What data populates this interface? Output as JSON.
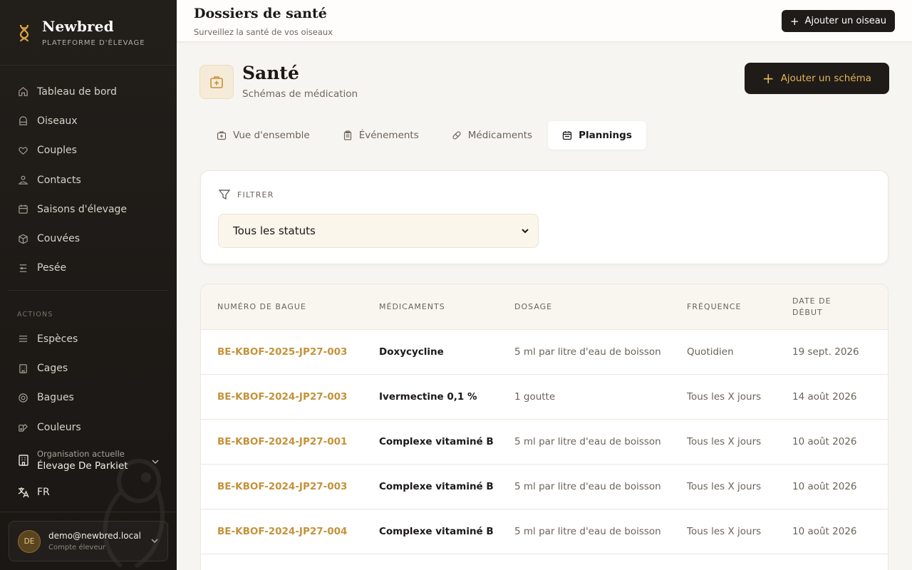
{
  "app": {
    "name": "Newbred",
    "tagline": "PLATEFORME D'ÉLEVAGE"
  },
  "sidebar": {
    "items": [
      {
        "label": "Tableau de bord",
        "icon": "home-icon"
      },
      {
        "label": "Oiseaux",
        "icon": "cage-icon"
      },
      {
        "label": "Couples",
        "icon": "heart-icon"
      },
      {
        "label": "Contacts",
        "icon": "users-icon"
      },
      {
        "label": "Saisons d'élevage",
        "icon": "calendar-icon"
      },
      {
        "label": "Couvées",
        "icon": "box-icon"
      },
      {
        "label": "Pesée",
        "icon": "scale-icon"
      }
    ],
    "actions_title": "ACTIONS",
    "actions": [
      {
        "label": "Espèces",
        "icon": "list-icon"
      },
      {
        "label": "Cages",
        "icon": "building-icon"
      },
      {
        "label": "Bagues",
        "icon": "ring-icon"
      },
      {
        "label": "Couleurs",
        "icon": "palette-icon"
      }
    ],
    "org_label": "Organisation actuelle",
    "org_name": "Élevage De Parkiet",
    "language": "FR",
    "user": {
      "initials": "DE",
      "email": "demo@newbred.local",
      "role": "Compte éleveur"
    }
  },
  "header": {
    "title": "Dossiers de santé",
    "subtitle": "Surveillez la santé de vos oiseaux",
    "add_bird_label": "Ajouter un oiseau"
  },
  "main": {
    "title": "Santé",
    "subtitle": "Schémas de médication",
    "add_schema_label": "Ajouter un schéma",
    "tabs": [
      {
        "label": "Vue d'ensemble",
        "icon": "medkit-icon",
        "active": false
      },
      {
        "label": "Événements",
        "icon": "clipboard-icon",
        "active": false
      },
      {
        "label": "Médicaments",
        "icon": "pill-icon",
        "active": false
      },
      {
        "label": "Plannings",
        "icon": "calendar-icon",
        "active": true
      }
    ],
    "filter": {
      "title": "FILTRER",
      "status_value": "Tous les statuts"
    },
    "table": {
      "headers": [
        "NUMÉRO DE BAGUE",
        "MÉDICAMENTS",
        "DOSAGE",
        "FRÉQUENCE",
        "DATE DE DÉBUT"
      ],
      "header_date_line1": "DATE DE",
      "header_date_line2": "DÉBUT",
      "rows": [
        {
          "ring": "BE-KBOF-2025-JP27-003",
          "med": "Doxycycline",
          "dose": "5 ml par litre d'eau de boisson",
          "freq": "Quotidien",
          "date": "19 sept. 2026"
        },
        {
          "ring": "BE-KBOF-2024-JP27-003",
          "med": "Ivermectine 0,1 %",
          "dose": "1 goutte",
          "freq": "Tous les X jours",
          "date": "14 août 2026"
        },
        {
          "ring": "BE-KBOF-2024-JP27-001",
          "med": "Complexe vitaminé B",
          "dose": "5 ml par litre d'eau de boisson",
          "freq": "Tous les X jours",
          "date": "10 août 2026"
        },
        {
          "ring": "BE-KBOF-2024-JP27-003",
          "med": "Complexe vitaminé B",
          "dose": "5 ml par litre d'eau de boisson",
          "freq": "Tous les X jours",
          "date": "10 août 2026"
        },
        {
          "ring": "BE-KBOF-2024-JP27-004",
          "med": "Complexe vitaminé B",
          "dose": "5 ml par litre d'eau de boisson",
          "freq": "Tous les X jours",
          "date": "10 août 2026"
        }
      ]
    }
  },
  "colors": {
    "accent": "#c4923a",
    "sidebar_bg": "#1f1b18",
    "button_dark": "#1f1b18",
    "button_accent_text": "#e2b55b"
  }
}
